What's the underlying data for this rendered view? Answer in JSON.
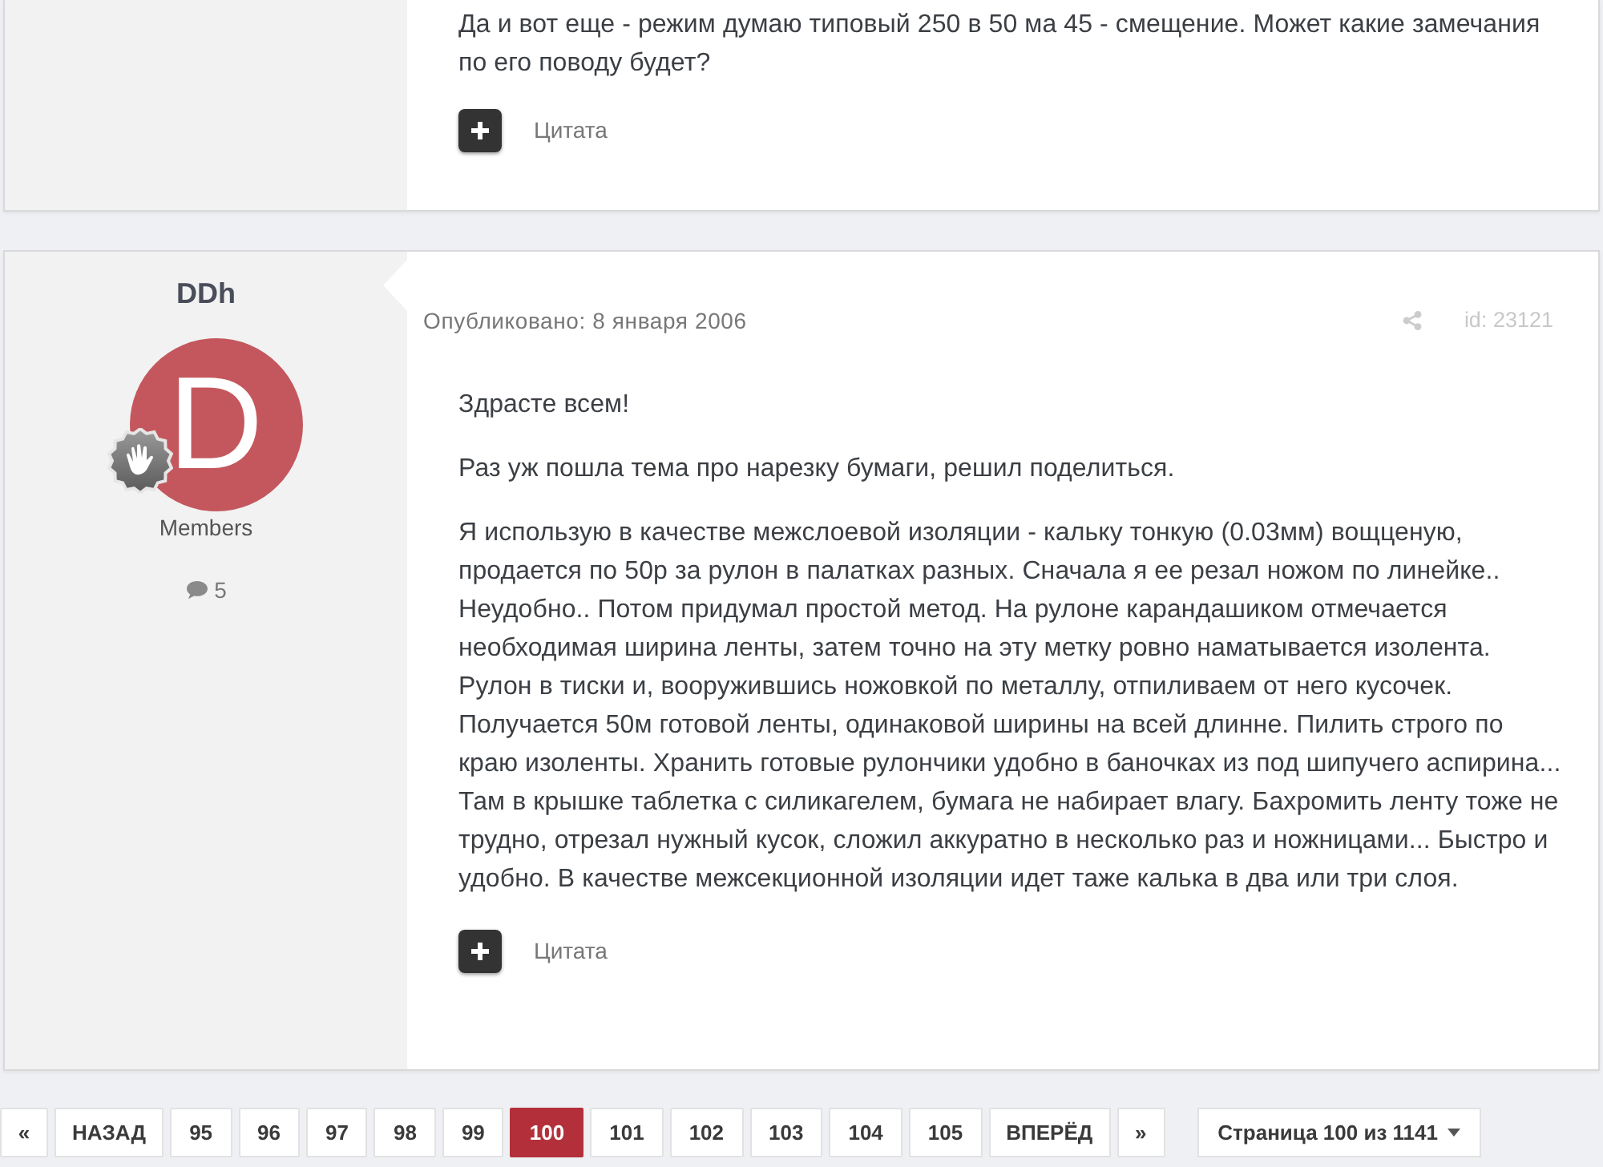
{
  "previous_post": {
    "paragraphs": [
      "Да и вот еще - режим думаю типовый 250 в 50 ма 45 - смещение. Может какие замечания по его поводу будет?"
    ],
    "quote_label": "Цитата"
  },
  "post": {
    "author": {
      "name": "DDh",
      "avatar_letter": "D",
      "group": "Members",
      "post_count": "5"
    },
    "published": "Опубликовано: 8 января 2006",
    "post_id": "id: 23121",
    "paragraphs": [
      "Здрасте всем!",
      "Раз уж пошла тема про нарезку бумаги, решил поделиться.",
      "Я использую в качестве межслоевой изоляции - кальку тонкую (0.03мм) вощценую, продается по 50р за рулон в палатках разных. Сначала я ее резал ножом по линейке.. Неудобно.. Потом придумал простой метод. На рулоне карандашиком отмечается необходимая ширина ленты, затем точно на эту метку ровно наматывается изолента. Рулон в тиски и, вооружившись ножовкой по металлу, отпиливаем от него кусочек. Получается 50м готовой ленты, одинаковой ширины на всей длинне. Пилить строго по краю изоленты. Хранить готовые рулончики удобно в баночках из под шипучего аспирина... Там в крышке таблетка с силикагелем, бумага не набирает влагу. Бахромить ленту тоже не трудно, отрезал нужный кусок, сложил аккуратно в несколько раз и ножницами... Быстро и удобно. В качестве межсекционной изоляции идет таже калька в два или три слоя."
    ],
    "quote_label": "Цитата"
  },
  "pagination": {
    "first": "«",
    "prev": "НАЗАД",
    "pages": [
      {
        "label": "95",
        "selected": false
      },
      {
        "label": "96",
        "selected": false
      },
      {
        "label": "97",
        "selected": false
      },
      {
        "label": "98",
        "selected": false
      },
      {
        "label": "99",
        "selected": false
      },
      {
        "label": "100",
        "selected": true
      },
      {
        "label": "101",
        "selected": false
      },
      {
        "label": "102",
        "selected": false
      },
      {
        "label": "103",
        "selected": false
      },
      {
        "label": "104",
        "selected": false
      },
      {
        "label": "105",
        "selected": false
      }
    ],
    "next": "ВПЕРЁД",
    "last": "»",
    "page_jump": "Страница 100 из 1141"
  }
}
